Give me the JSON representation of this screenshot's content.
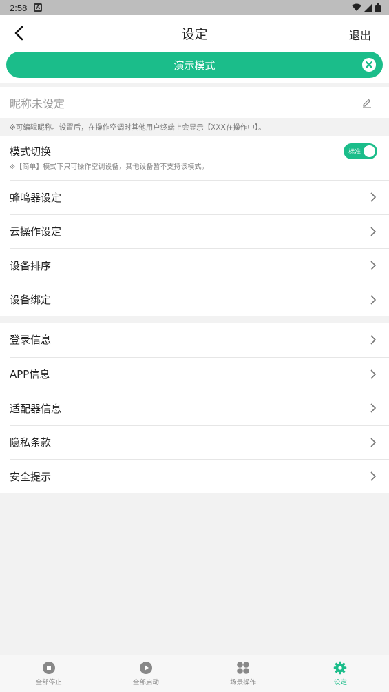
{
  "status_bar": {
    "time": "2:58"
  },
  "header": {
    "title": "设定",
    "logout_label": "退出"
  },
  "demo_banner": {
    "label": "演示模式"
  },
  "nickname": {
    "text": "昵称未设定",
    "hint": "※可编辑昵称。设置后，在操作空调时其他用户终端上会显示【XXX在操作中】。"
  },
  "mode": {
    "title": "模式切换",
    "description": "※【简单】模式下只可操作空调设备，其他设备暂不支持该模式。",
    "toggle_label": "标准"
  },
  "section1": [
    {
      "label": "蜂鸣器设定"
    },
    {
      "label": "云操作设定"
    },
    {
      "label": "设备排序"
    },
    {
      "label": "设备绑定"
    }
  ],
  "section2": [
    {
      "label": "登录信息"
    },
    {
      "label": "APP信息"
    },
    {
      "label": "适配器信息"
    },
    {
      "label": "隐私条款"
    },
    {
      "label": "安全提示"
    }
  ],
  "bottom_nav": [
    {
      "label": "全部停止",
      "icon": "stop-icon"
    },
    {
      "label": "全部启动",
      "icon": "play-icon"
    },
    {
      "label": "场景操作",
      "icon": "scene-icon"
    },
    {
      "label": "设定",
      "icon": "gear-icon"
    }
  ],
  "colors": {
    "accent": "#1bbd8a",
    "status_bar": "#bdbdbd",
    "background": "#f2f2f2"
  }
}
